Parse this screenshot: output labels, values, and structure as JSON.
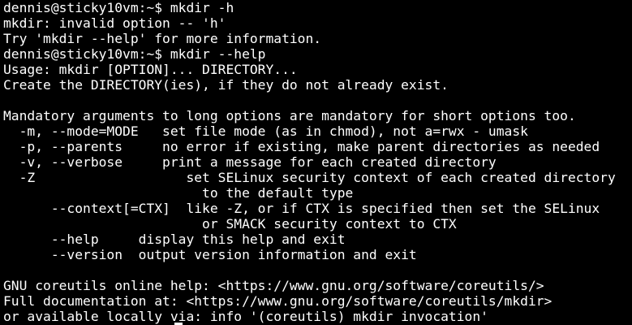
{
  "terminal": {
    "foreground": "#ffffff",
    "background": "#000000",
    "lines": [
      "dennis@sticky10vm:~$ mkdir -h",
      "mkdir: invalid option -- 'h'",
      "Try 'mkdir --help' for more information.",
      "dennis@sticky10vm:~$ mkdir --help",
      "Usage: mkdir [OPTION]... DIRECTORY...",
      "Create the DIRECTORY(ies), if they do not already exist.",
      "",
      "Mandatory arguments to long options are mandatory for short options too.",
      "  -m, --mode=MODE   set file mode (as in chmod), not a=rwx - umask",
      "  -p, --parents     no error if existing, make parent directories as needed",
      "  -v, --verbose     print a message for each created directory",
      "  -Z                   set SELinux security context of each created directory",
      "                         to the default type",
      "      --context[=CTX]  like -Z, or if CTX is specified then set the SELinux",
      "                         or SMACK security context to CTX",
      "      --help     display this help and exit",
      "      --version  output version information and exit",
      "",
      "GNU coreutils online help: <https://www.gnu.org/software/coreutils/>",
      "Full documentation at: <https://www.gnu.org/software/coreutils/mkdir>",
      "or available locally via: info '(coreutils) mkdir invocation'"
    ]
  }
}
